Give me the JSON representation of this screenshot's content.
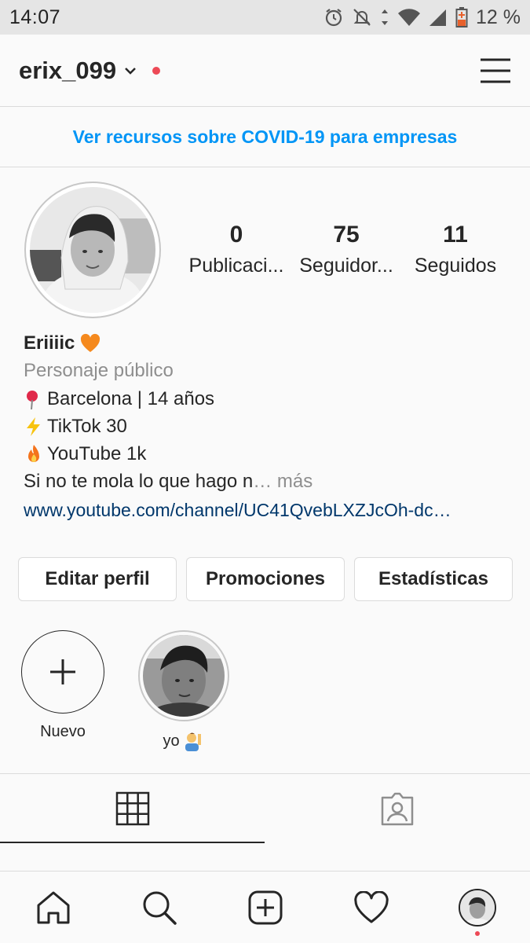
{
  "status_bar": {
    "time": "14:07",
    "battery": "12 %"
  },
  "header": {
    "username": "erix_099"
  },
  "banner": {
    "link_text": "Ver recursos sobre COVID-19 para empresas"
  },
  "stats": [
    {
      "value": "0",
      "label": "Publicaci..."
    },
    {
      "value": "75",
      "label": "Seguidor..."
    },
    {
      "value": "11",
      "label": "Seguidos"
    }
  ],
  "bio": {
    "name": "Eriiiic",
    "category": "Personaje público",
    "line1": "Barcelona | 14 años",
    "line2": "TikTok 30",
    "line3": "YouTube 1k",
    "line4": "Si no te mola lo que hago n",
    "more": "… más",
    "link": "www.youtube.com/channel/UC41QvebLXZJcOh-dc…"
  },
  "buttons": {
    "edit": "Editar perfil",
    "promos": "Promociones",
    "stats": "Estadísticas"
  },
  "highlights": [
    {
      "label": "Nuevo"
    },
    {
      "label": "yo"
    }
  ],
  "colors": {
    "link": "#0095f6",
    "bio_link": "#00376b",
    "notification": "#ed4956",
    "heart_emoji": "#f5891d"
  }
}
